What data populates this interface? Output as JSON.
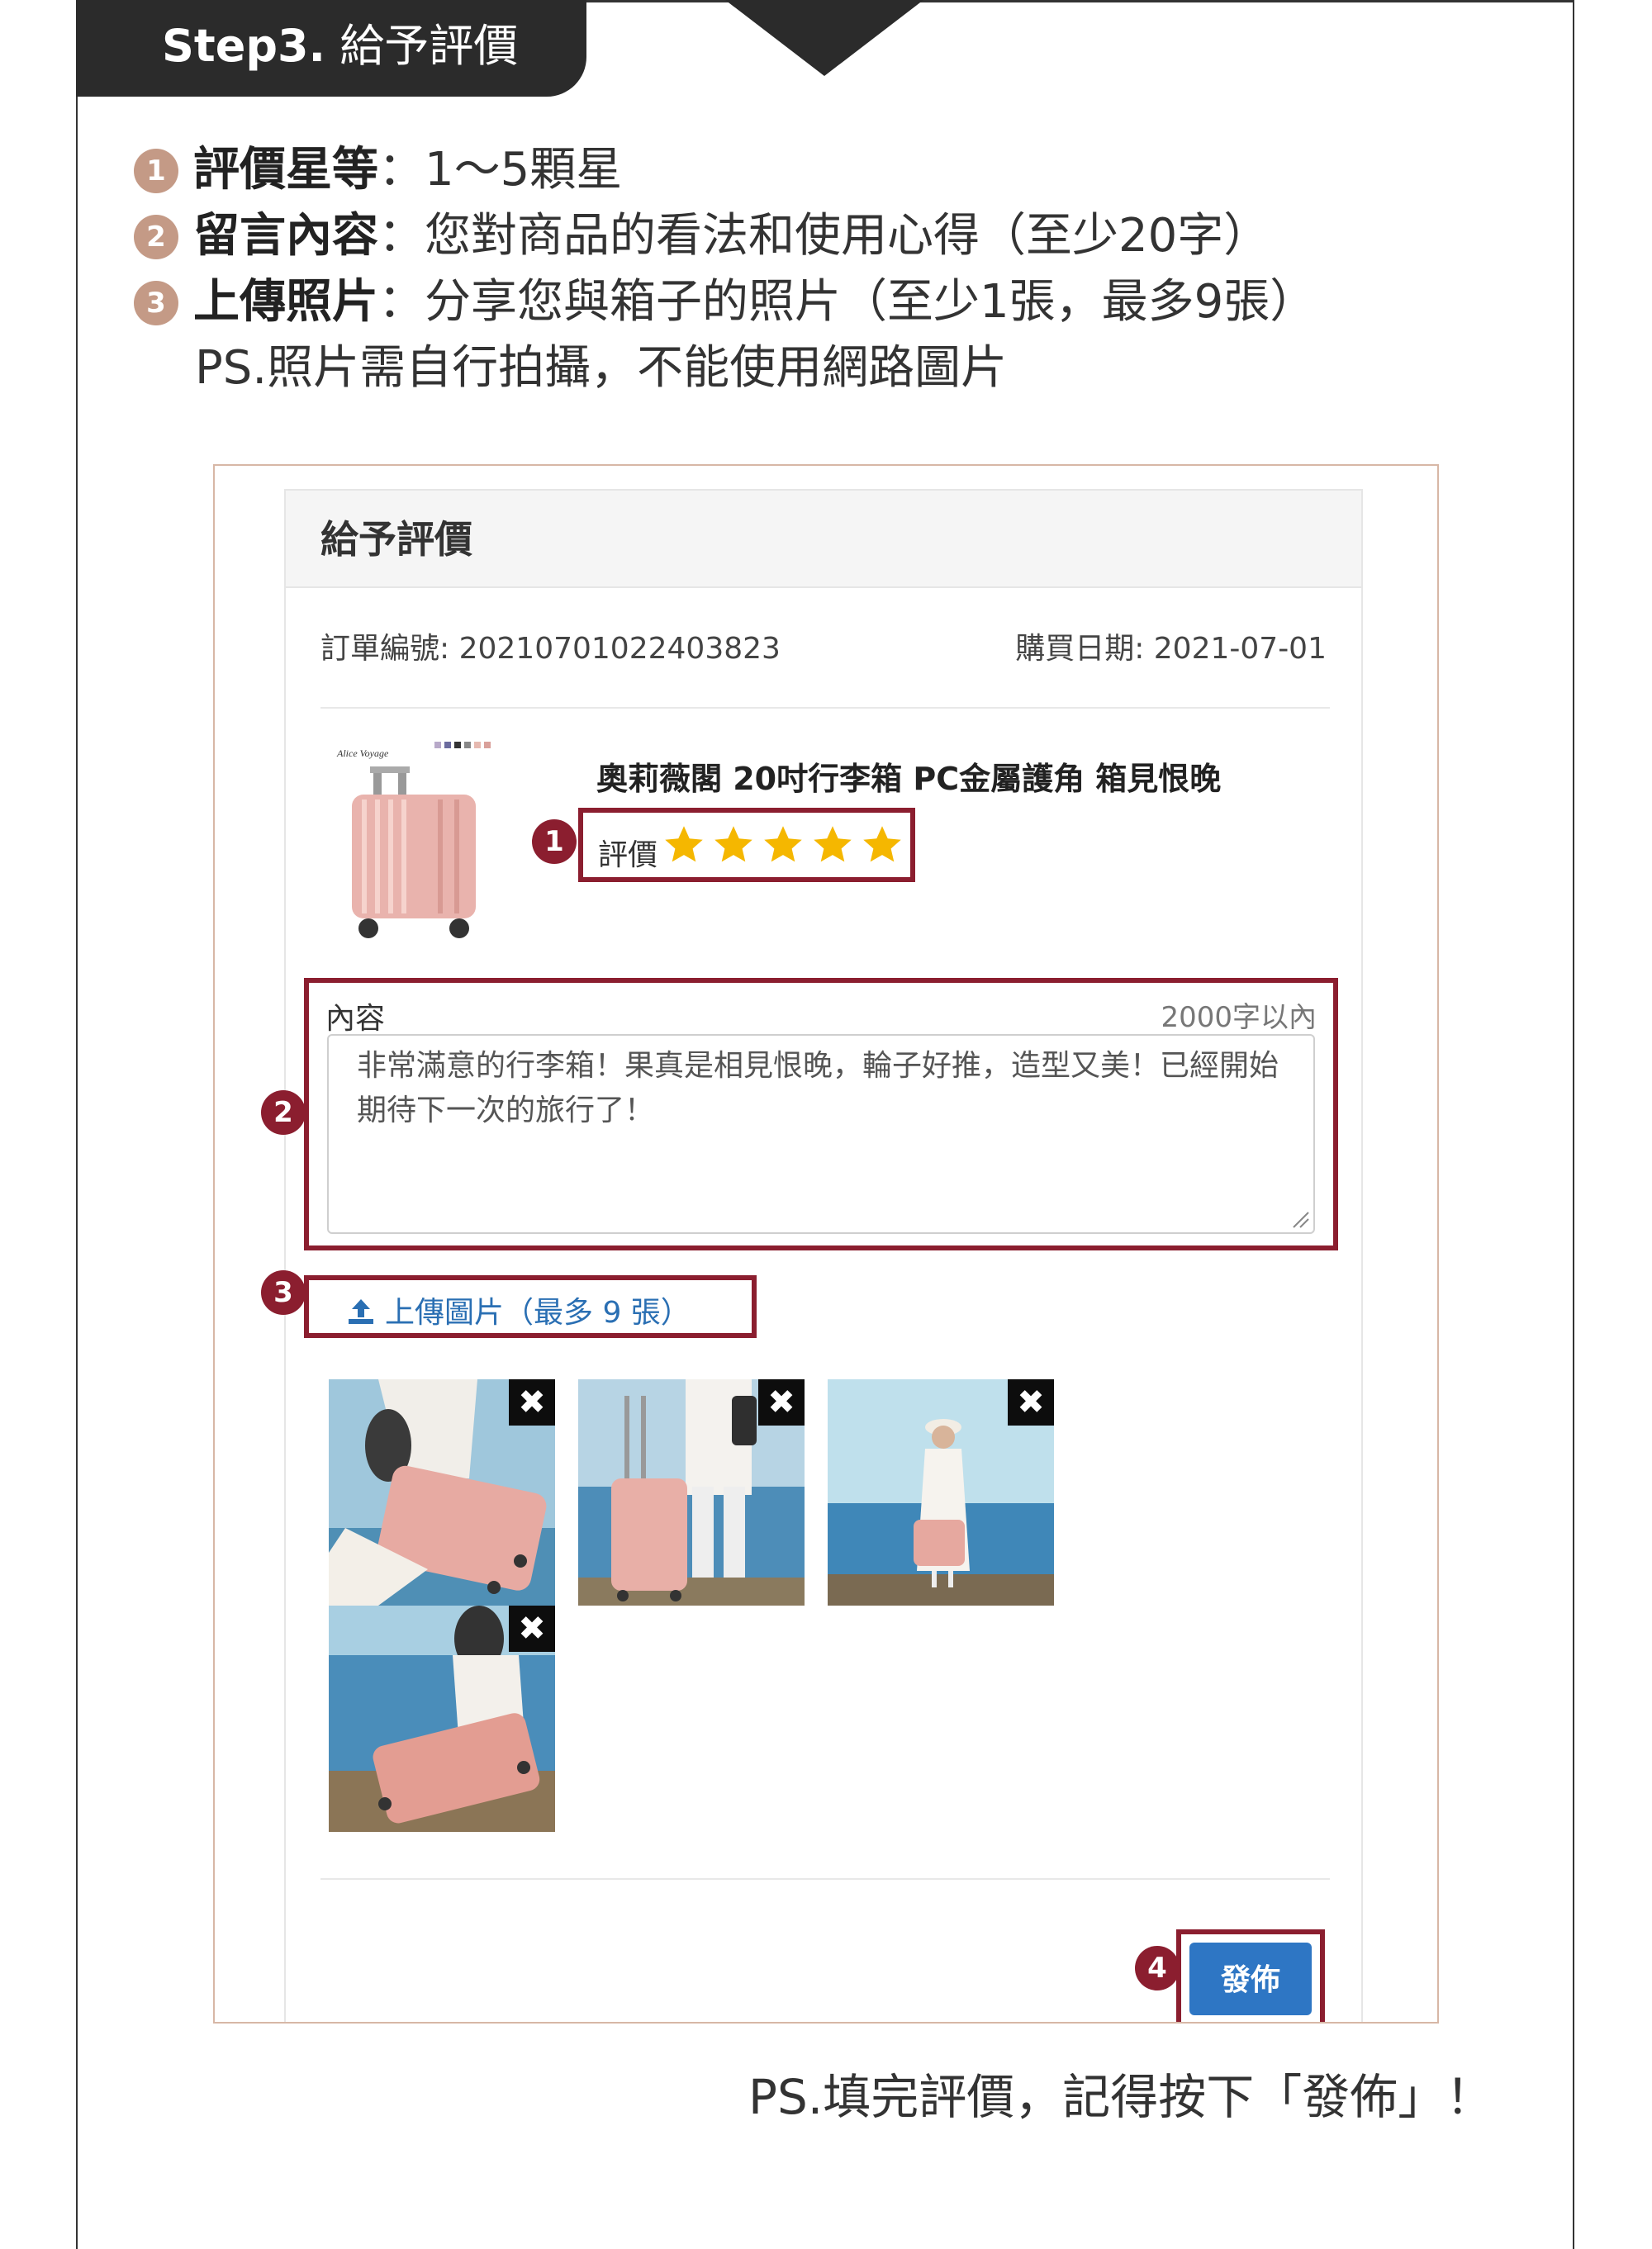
{
  "step": {
    "prefix": "Step3.",
    "title": "給予評價"
  },
  "instructions": [
    {
      "num": "1",
      "label": "評價星等",
      "text": "：1～5顆星"
    },
    {
      "num": "2",
      "label": "留言內容",
      "text": "：您對商品的看法和使用心得（至少20字）"
    },
    {
      "num": "3",
      "label": "上傳照片",
      "text": "：分享您與箱子的照片（至少1張，最多9張）"
    }
  ],
  "ps_photo": "PS.照片需自行拍攝，不能使用網路圖片",
  "form": {
    "title": "給予評價",
    "order_no": "訂單編號: 20210701022403823",
    "purchase_date": "購買日期: 2021-07-01",
    "product_name": "奧莉薇閣 20吋行李箱 PC金屬護角 箱見恨晚",
    "rating_label": "評價",
    "rating_value": 5,
    "rating_max": 5,
    "star_color": "#f5b700",
    "content_label": "內容",
    "content_limit": "2000字以內",
    "content_text": "非常滿意的行李箱！果真是相見恨晚，輪子好推，造型又美！已經開始期待下一次的旅行了！",
    "upload_label": "上傳圖片（最多 9 張）",
    "upload_icon": "upload-icon",
    "delete_symbol": "✖",
    "photo_count": 4,
    "publish_label": "發佈"
  },
  "callouts": [
    "1",
    "2",
    "3",
    "4"
  ],
  "ps_publish": "PS.填完評價，記得按下「發佈」！",
  "colors": {
    "accent": "#8b1e2f",
    "button": "#2e76c4",
    "badge": "#c49a86",
    "tab": "#2b2b2b"
  }
}
